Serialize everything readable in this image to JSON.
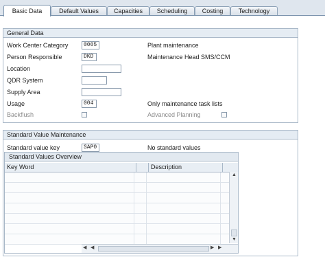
{
  "tabs": [
    "Basic Data",
    "Default Values",
    "Capacities",
    "Scheduling",
    "Costing",
    "Technology"
  ],
  "general": {
    "title": "General Data",
    "work_center_category_label": "Work Center Category",
    "work_center_category_value": "0005",
    "work_center_category_desc": "Plant maintenance",
    "person_responsible_label": "Person Responsible",
    "person_responsible_value": "DKD",
    "person_responsible_desc": "Maintenance Head SMS/CCM",
    "location_label": "Location",
    "location_value": "",
    "qdr_label": "QDR System",
    "qdr_value": "",
    "supply_area_label": "Supply Area",
    "supply_area_value": "",
    "usage_label": "Usage",
    "usage_value": "004",
    "usage_desc": "Only maintenance task lists",
    "backflush_label": "Backflush",
    "advanced_planning_label": "Advanced Planning"
  },
  "standard": {
    "title": "Standard Value Maintenance",
    "key_label": "Standard value key",
    "key_value": "SAP0",
    "key_desc": "No standard values"
  },
  "table": {
    "title": "Standard Values Overview",
    "columns": [
      "Key Word",
      "",
      "Description"
    ],
    "rows": [
      [],
      [],
      [],
      [],
      [],
      [],
      []
    ]
  },
  "icons": {
    "table_settings": "table-settings-icon",
    "scroll_up": "scroll-up-icon",
    "scroll_down": "scroll-down-icon",
    "scroll_left": "scroll-left-icon",
    "scroll_right": "scroll-right-icon"
  }
}
